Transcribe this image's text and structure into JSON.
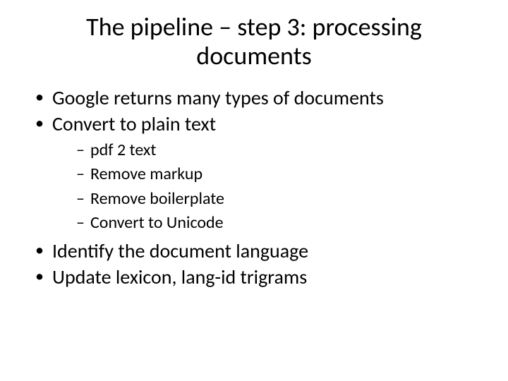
{
  "slide": {
    "title": "The pipeline – step 3: processing documents",
    "bullets": [
      {
        "text": "Google returns many types of documents"
      },
      {
        "text": "Convert to plain text",
        "sub": [
          "pdf 2 text",
          "Remove markup",
          "Remove boilerplate",
          "Convert to Unicode"
        ]
      },
      {
        "text": "Identify the document language"
      },
      {
        "text": "Update lexicon, lang-id trigrams"
      }
    ]
  }
}
